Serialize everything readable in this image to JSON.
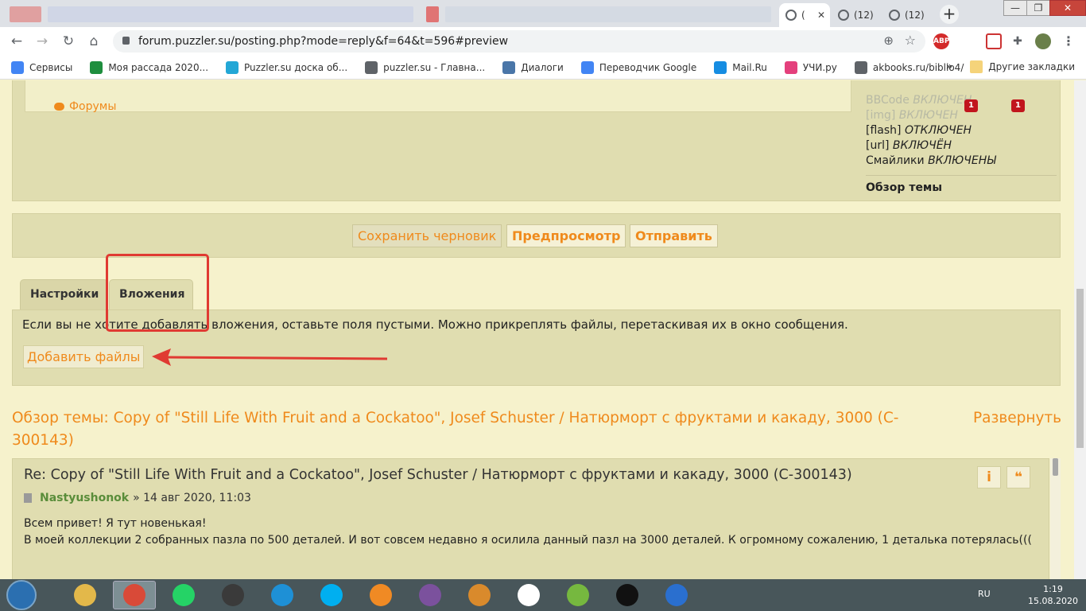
{
  "browser": {
    "tabs": [
      {
        "title": "("
      },
      {
        "title": "(12)"
      },
      {
        "title": "(12)"
      }
    ],
    "new_tab_label": "+",
    "window_controls": {
      "minimize": "—",
      "maximize": "❐",
      "close": "✕"
    },
    "address": "forum.puzzler.su/posting.php?mode=reply&f=64&t=596#preview",
    "extensions": {
      "abp": "ABP"
    },
    "bookmarks": [
      {
        "label": "Сервисы",
        "icon": "apps-grid-icon",
        "color": "#4285f4"
      },
      {
        "label": "Моя рассада 2020...",
        "icon": "green-plus-icon",
        "color": "#1e8e3e"
      },
      {
        "label": "Puzzler.su доска об...",
        "icon": "puzzler-icon",
        "color": "#23a7d6"
      },
      {
        "label": "puzzler.su - Главна...",
        "icon": "globe-icon",
        "color": "#5f6368"
      },
      {
        "label": "Диалоги",
        "icon": "chat-icon",
        "color": "#4a76a8"
      },
      {
        "label": "Переводчик Google",
        "icon": "translate-icon",
        "color": "#4285f4"
      },
      {
        "label": "Mail.Ru",
        "icon": "mailru-icon",
        "color": "#168de2"
      },
      {
        "label": "УЧИ.ру",
        "icon": "uchi-icon",
        "color": "#e4407c"
      },
      {
        "label": "akbooks.ru/biblio4/",
        "icon": "globe-icon",
        "color": "#5f6368"
      }
    ],
    "bookmarks_more": "»",
    "other_bookmarks": "Другие закладки"
  },
  "forum": {
    "forums_link": "Форумы",
    "options": {
      "bbcode_label": "BBCode",
      "bbcode_state": "ВКЛЮЧЕН",
      "img_label": "[img]",
      "img_state": "ВКЛЮЧЕН",
      "flash_label": "[flash]",
      "flash_state": "ОТКЛЮЧЕН",
      "url_label": "[url]",
      "url_state": "ВКЛЮЧЁН",
      "smilies_label": "Смайлики",
      "smilies_state": "ВКЛЮЧЕНЫ",
      "topic_review": "Обзор темы"
    },
    "notification_badges": [
      "1",
      "1"
    ],
    "buttons": {
      "save_draft": "Сохранить черновик",
      "preview": "Предпросмотр",
      "submit": "Отправить"
    },
    "panel_tabs": [
      {
        "label": "Настройки"
      },
      {
        "label": "Вложения"
      }
    ],
    "attachments": {
      "hint": "Если вы не хотите добавлять вложения, оставьте поля пустыми. Можно прикреплять файлы, перетаскивая их в окно сообщения.",
      "add_files": "Добавить файлы"
    },
    "review": {
      "title": "Обзор темы: Copy of \"Still Life With Fruit and a Cockatoo\", Josef Schuster / Натюрморт с фруктами и какаду, 3000 (C-300143)",
      "expand": "Развернуть"
    },
    "post": {
      "title": "Re: Copy of \"Still Life With Fruit and a Cockatoo\", Josef Schuster / Натюрморт с фруктами и какаду, 3000 (C-300143)",
      "author": "Nastyushonok",
      "date": "» 14 авг 2020, 11:03",
      "body_line1": "Всем привет! Я тут новенькая!",
      "body_line2": "В моей коллекции 2 собранных пазла по 500 деталей. И вот совсем недавно я осилила данный пазл на 3000 деталей. К огромному сожалению, 1 деталька потерялась(((",
      "info_button": "i",
      "quote_button": "❝"
    }
  },
  "taskbar": {
    "lang": "RU",
    "time": "1:19",
    "date": "15.08.2020",
    "apps": [
      {
        "icon": "explorer-icon",
        "color": "#e3b84a"
      },
      {
        "icon": "chrome-icon",
        "color": "#d94a38"
      },
      {
        "icon": "whatsapp-icon",
        "color": "#25d366"
      },
      {
        "icon": "game-soldier-icon",
        "color": "#3a3a3a"
      },
      {
        "icon": "internet-explorer-icon",
        "color": "#1e90d6"
      },
      {
        "icon": "skype-icon",
        "color": "#00aff0"
      },
      {
        "icon": "media-player-icon",
        "color": "#f08a24"
      },
      {
        "icon": "viber-icon",
        "color": "#7b519d"
      },
      {
        "icon": "counter-strike-icon",
        "color": "#d98a2c"
      },
      {
        "icon": "yandex-browser-icon",
        "color": "#ffffff"
      },
      {
        "icon": "utorrent-icon",
        "color": "#76b83f"
      },
      {
        "icon": "settings-gear-icon",
        "color": "#111111"
      },
      {
        "icon": "ufo-app-icon",
        "color": "#2a6fcf"
      }
    ]
  },
  "colors": {
    "accent_orange": "#ef8a1c",
    "panel_bg": "#e0ddb0",
    "page_bg": "#f6f2cc",
    "annotation_red": "#e03a32",
    "author_green": "#5a8d3a"
  }
}
